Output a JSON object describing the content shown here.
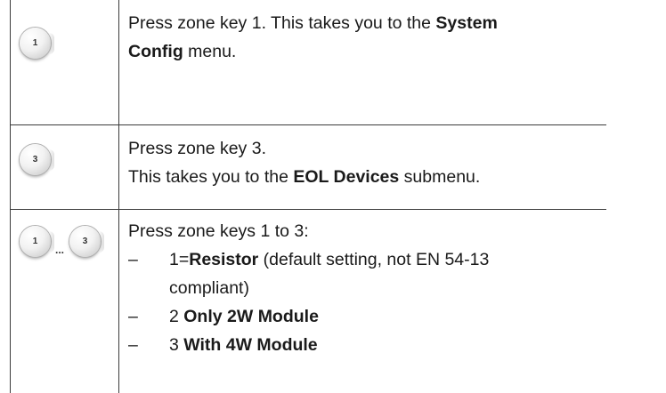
{
  "rows": [
    {
      "keys": [
        "1"
      ],
      "text_pre": "Press zone key 1. This takes you to the ",
      "text_bold1": "System",
      "text_bold2": "Config",
      "text_post": " menu."
    },
    {
      "keys": [
        "3"
      ],
      "line1": "Press zone key 3.",
      "line2_pre": "This takes you to the ",
      "line2_bold": "EOL Devices",
      "line2_post": " submenu."
    },
    {
      "keys": [
        "1",
        "3"
      ],
      "ellipsis": "...",
      "intro": "Press zone keys 1 to 3:",
      "items": [
        {
          "dash": "–",
          "prefix": "1=",
          "bold": "Resistor",
          "suffix": " (default setting, not EN 54-13",
          "cont": "compliant)"
        },
        {
          "dash": "–",
          "prefix": "2 ",
          "bold": "Only 2W Module",
          "suffix": ""
        },
        {
          "dash": "–",
          "prefix": "3 ",
          "bold": "With 4W Module",
          "suffix": ""
        }
      ]
    }
  ]
}
